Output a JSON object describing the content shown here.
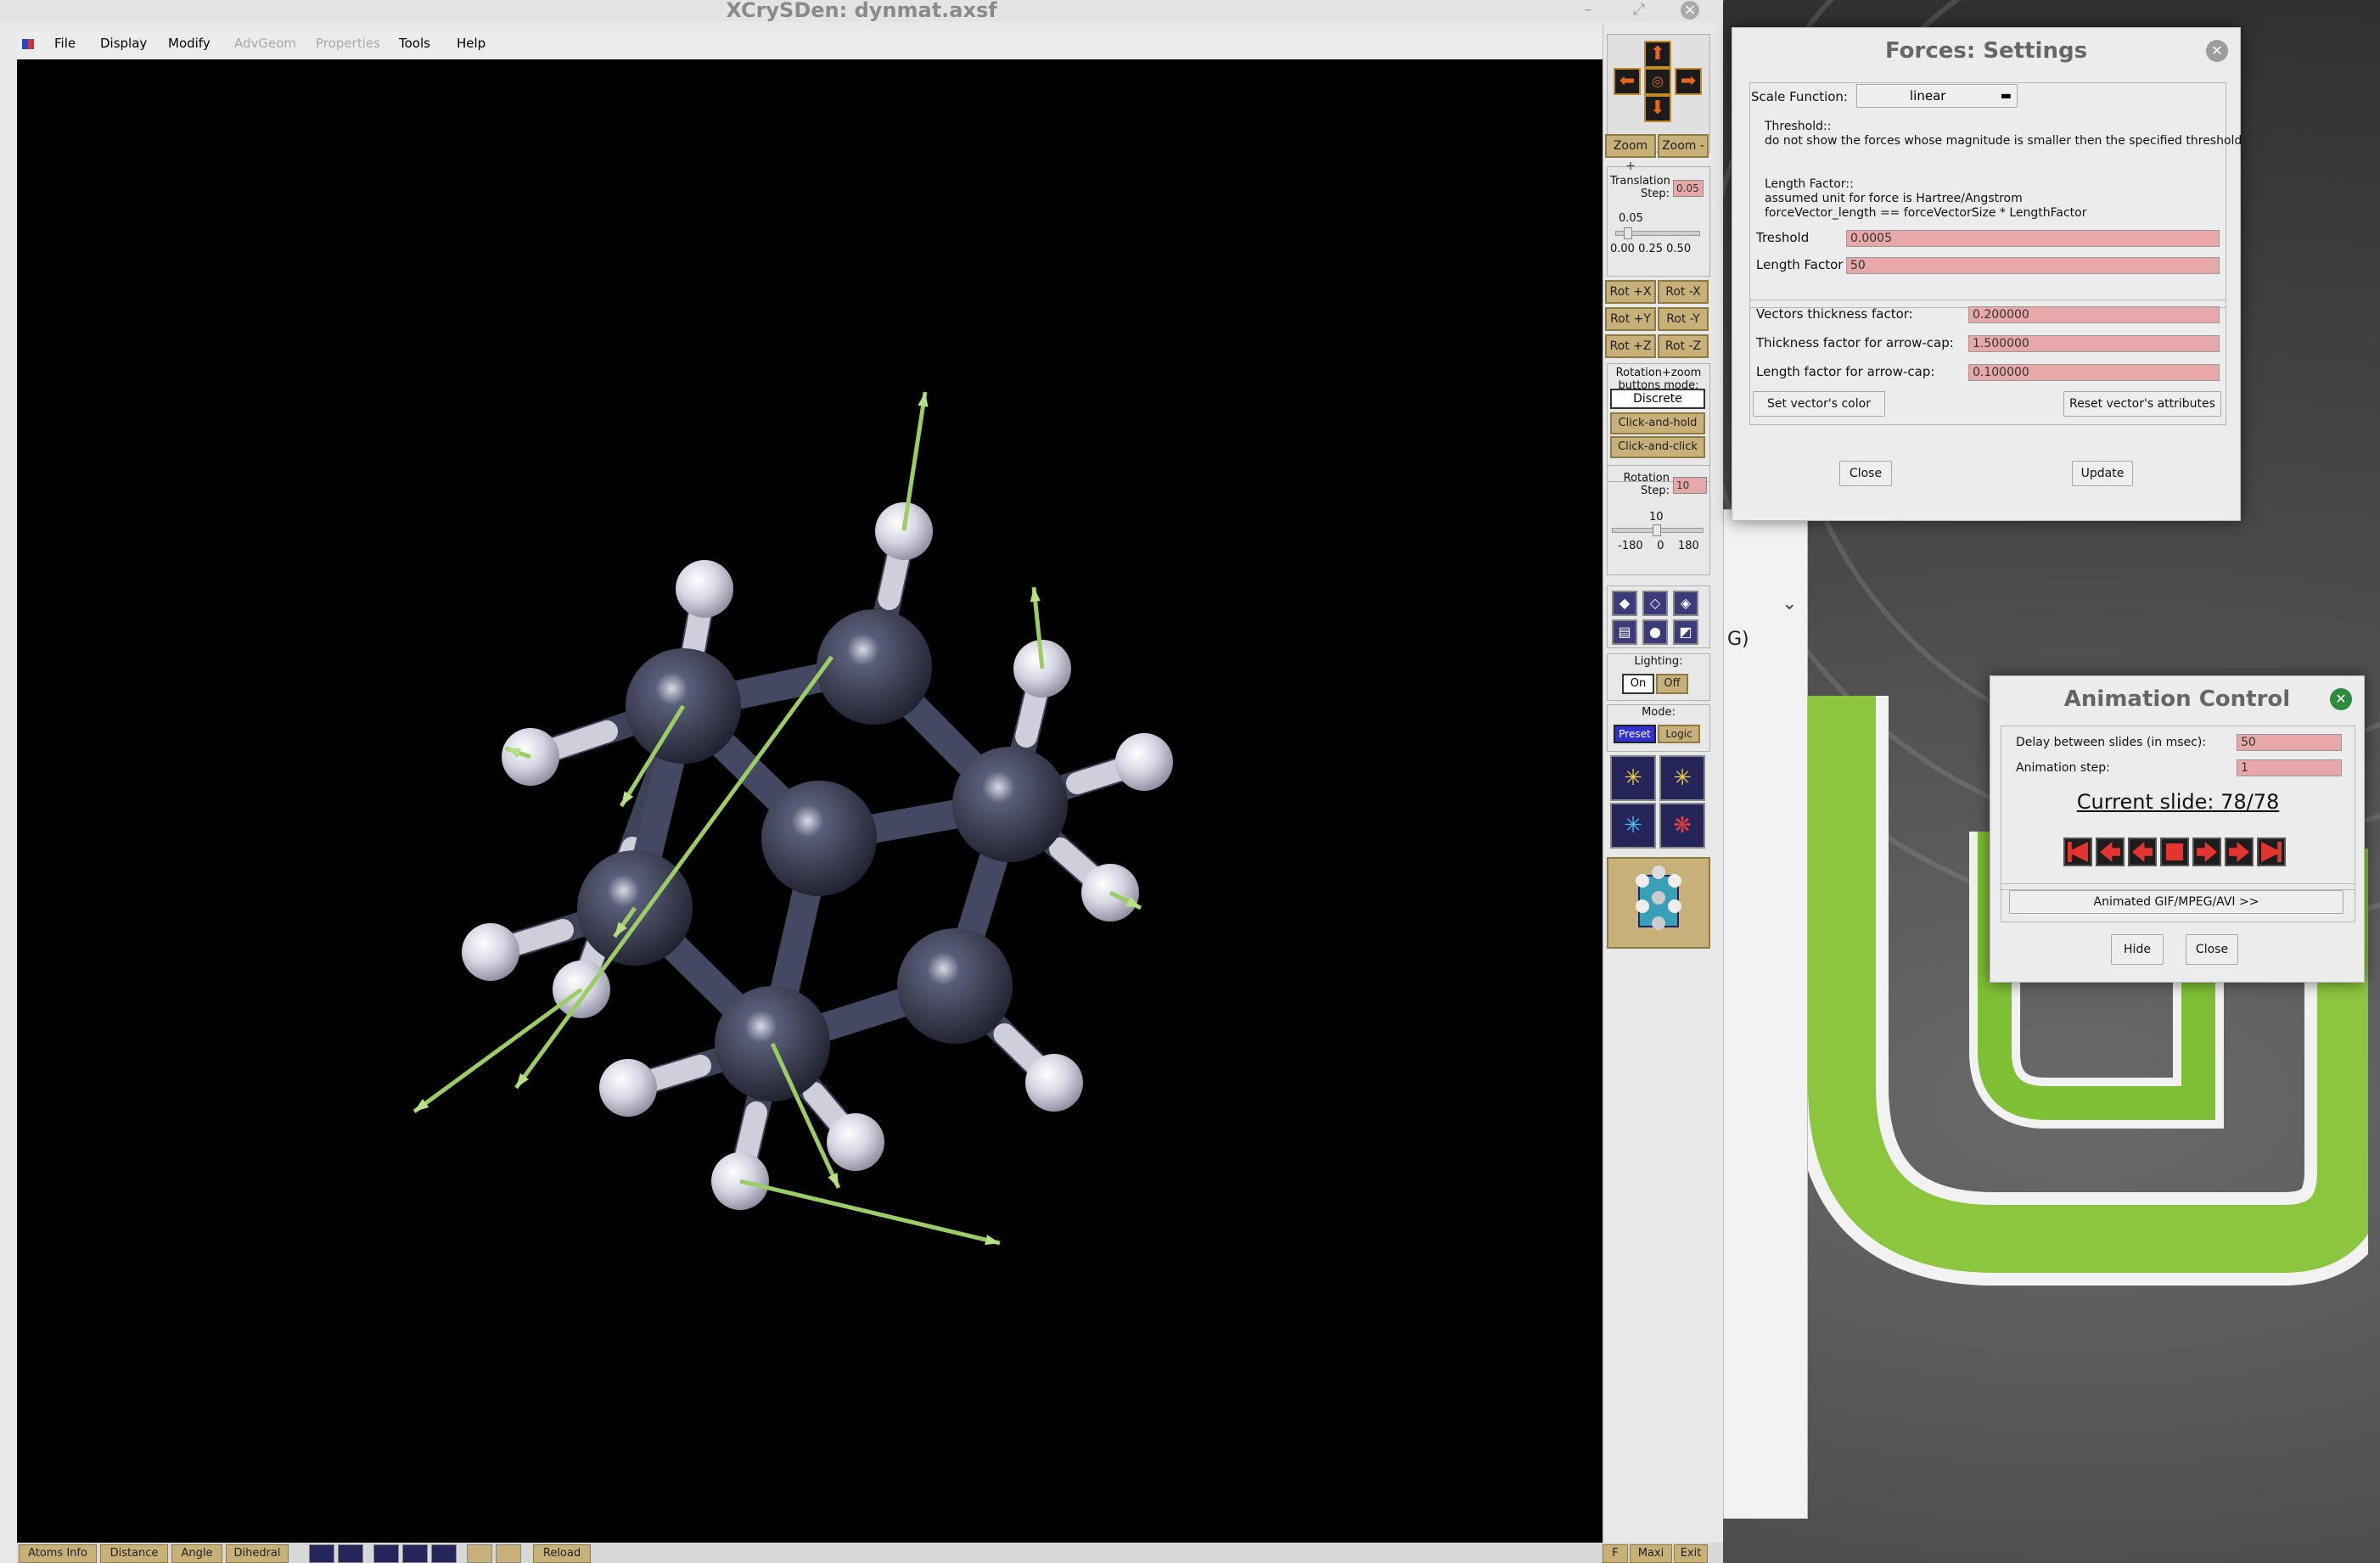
{
  "window": {
    "title": "XCrySDen: dynmat.axsf"
  },
  "menu": {
    "file": "File",
    "display": "Display",
    "modify": "Modify",
    "advgeom": "AdvGeom",
    "properties": "Properties",
    "tools": "Tools",
    "help": "Help"
  },
  "toolbar": {
    "zoom_in": "Zoom +",
    "zoom_out": "Zoom -",
    "translation_step_label": "Translation\nStep:",
    "translation_step_value": "0.05",
    "translation_scale_value": "0.05",
    "translation_scale_ticks": "0.00 0.25 0.50",
    "rot_px": "Rot +X",
    "rot_mx": "Rot -X",
    "rot_py": "Rot +Y",
    "rot_my": "Rot -Y",
    "rot_pz": "Rot +Z",
    "rot_mz": "Rot -Z",
    "rotation_mode_label": "Rotation+zoom\nbuttons mode:",
    "mode_discrete": "Discrete",
    "mode_click_hold": "Click-and-hold",
    "mode_click_click": "Click-and-click",
    "rotation_step_label": "Rotation\nStep:",
    "rotation_step_value": "10",
    "rotation_scale_value": "10",
    "rotation_scale_ticks": "-180    0    180",
    "lighting_label": "Lighting:",
    "lighting_on": "On",
    "lighting_off": "Off",
    "mode_label": "Mode:",
    "mode_preset": "Preset",
    "mode_logic": "Logic"
  },
  "bottombar": {
    "atoms_info": "Atoms Info",
    "distance": "Distance",
    "angle": "Angle",
    "dihedral": "Dihedral",
    "reload": "Reload",
    "f": "F",
    "maxi": "Maxi",
    "exit": "Exit"
  },
  "forces": {
    "title": "Forces: Settings",
    "scale_function_label": "Scale Function:",
    "scale_function_value": "linear",
    "threshold_text": "Threshold::\ndo not show the forces whose magnitude is smaller then the specified threshold.",
    "length_factor_text": "Length Factor::\nassumed unit for force is Hartree/Angstrom\nforceVector_length == forceVectorSize * LengthFactor",
    "treshold_label": "Treshold",
    "treshold_value": "0.0005",
    "length_factor_label": "Length Factor",
    "length_factor_value": "50",
    "vectors_thickness_label": "Vectors thickness factor:",
    "vectors_thickness_value": "0.200000",
    "arrow_thickness_label": "Thickness factor for arrow-cap:",
    "arrow_thickness_value": "1.500000",
    "arrow_length_label": "Length factor for arrow-cap:",
    "arrow_length_value": "0.100000",
    "set_color": "Set vector's color",
    "reset_attrs": "Reset vector's attributes",
    "close": "Close",
    "update": "Update"
  },
  "animation": {
    "title": "Animation Control",
    "delay_label": "Delay between slides (in msec):",
    "delay_value": "50",
    "step_label": "Animation step:",
    "step_value": "1",
    "current_slide": "Current slide: 78/78",
    "export": "Animated GIF/MPEG/AVI >>",
    "hide": "Hide",
    "close": "Close"
  },
  "behind": {
    "partial_text": "G)"
  },
  "colors": {
    "carbon": "#3a3d52",
    "hydrogen": "#e6e6ee",
    "force_vector": "#9ccc65",
    "button_gold": "#c8b079",
    "entry_pink": "#e6a8a8",
    "anim_red": "#e3342f"
  }
}
